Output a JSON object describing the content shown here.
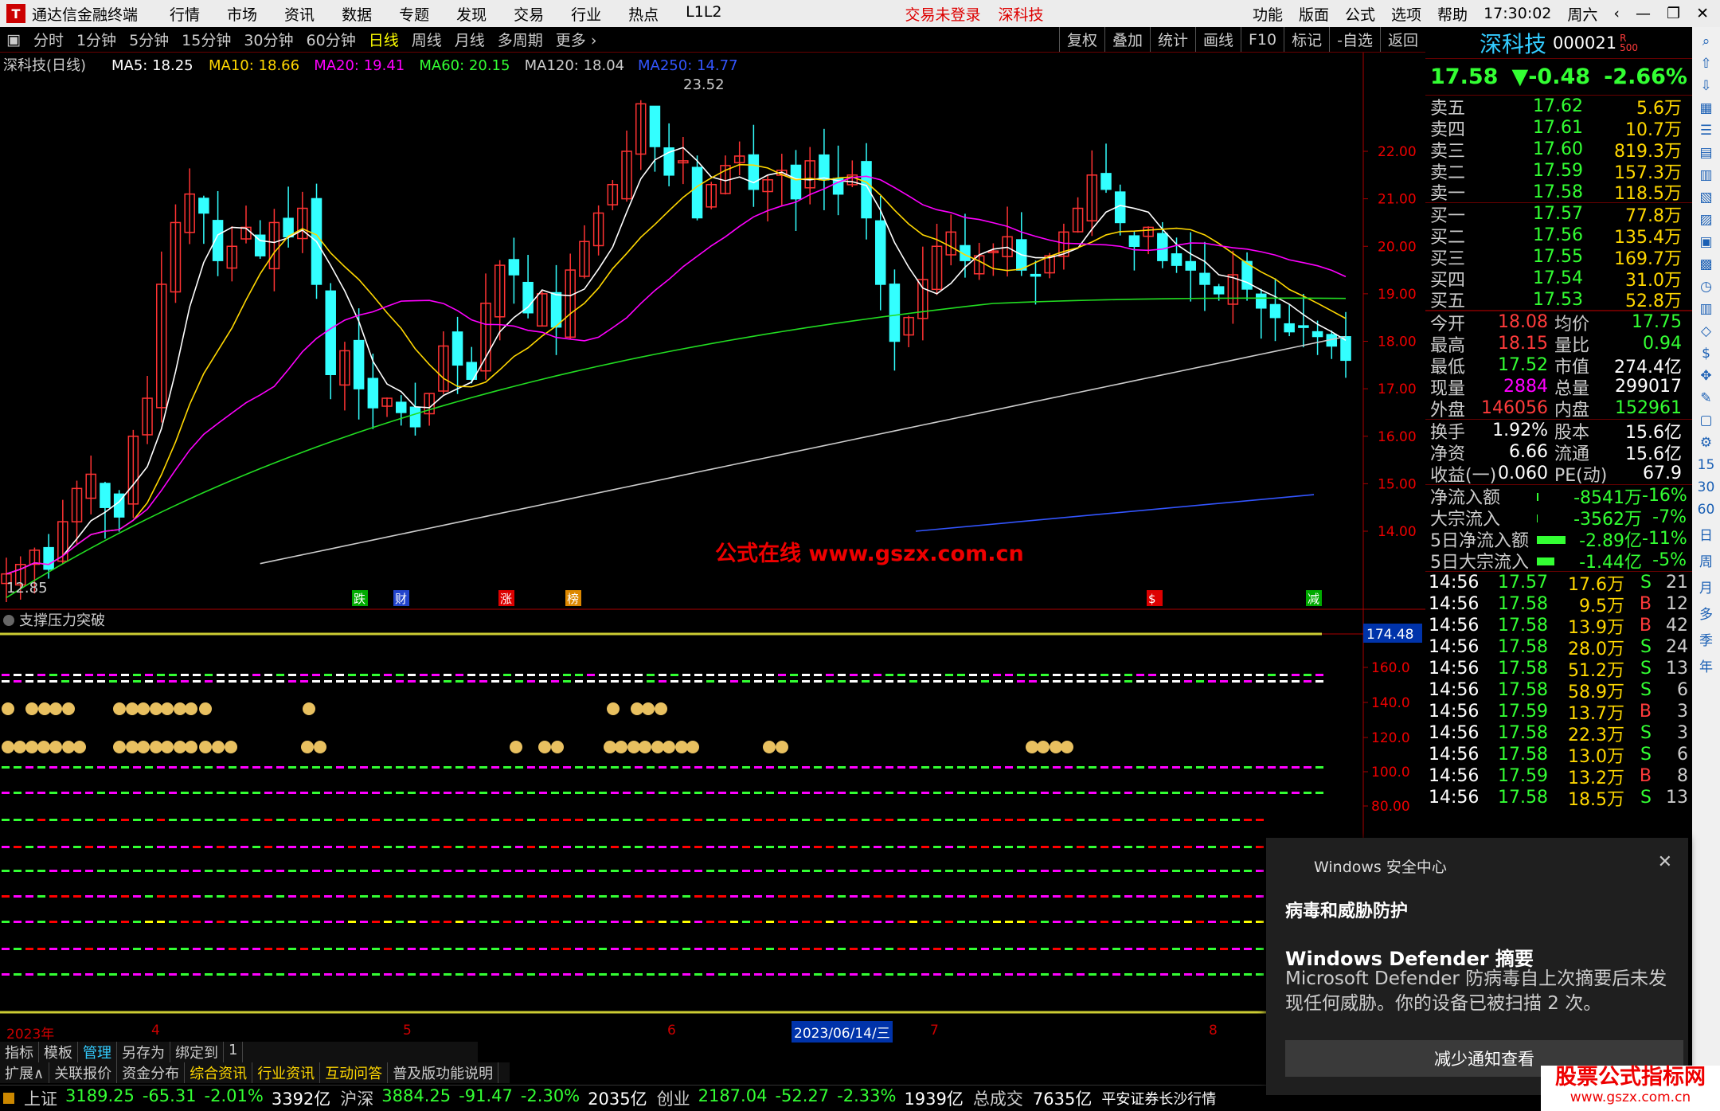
{
  "titlebar": {
    "app_title": "通达信金融终端",
    "menu": [
      "行情",
      "市场",
      "资讯",
      "数据",
      "专题",
      "发现",
      "交易",
      "行业",
      "热点",
      "L1L2"
    ],
    "warning": "交易未登录",
    "stock": "深科技",
    "right_menu": [
      "功能",
      "版面",
      "公式",
      "选项",
      "帮助"
    ],
    "time": "17:30:02",
    "weekday": "周六"
  },
  "periodbar": {
    "periods": [
      "分时",
      "1分钟",
      "5分钟",
      "15分钟",
      "30分钟",
      "60分钟",
      "日线",
      "周线",
      "月线",
      "多周期",
      "更多"
    ],
    "active": "日线",
    "tools": [
      "复权",
      "叠加",
      "统计",
      "画线",
      "F10",
      "标记",
      "-自选",
      "返回"
    ]
  },
  "ma_legend": {
    "name": "深科技(日线)",
    "items": [
      {
        "label": "MA5: 18.25",
        "color": "#ffffff"
      },
      {
        "label": "MA10: 18.66",
        "color": "#ffd700"
      },
      {
        "label": "MA20: 19.41",
        "color": "#ff00ff"
      },
      {
        "label": "MA60: 20.15",
        "color": "#33ff33"
      },
      {
        "label": "MA120: 18.04",
        "color": "#cccccc"
      },
      {
        "label": "MA250: 14.77",
        "color": "#3355ff"
      }
    ]
  },
  "main_chart": {
    "price_labels": [
      "22.00",
      "21.00",
      "20.00",
      "19.00",
      "18.00",
      "17.00",
      "16.00",
      "15.00",
      "14.00"
    ],
    "high_label": "23.52",
    "low_label": "12.85",
    "watermark": "公式在线  www.gszx.com.cn",
    "event_tags": [
      "跌",
      "财",
      "涨",
      "榜",
      "$",
      "减"
    ]
  },
  "indicator": {
    "name": "支撑压力突破",
    "value_box": "174.48",
    "axis": [
      "160.0",
      "140.0",
      "120.0",
      "100.0",
      "80.00"
    ]
  },
  "time_axis": [
    "2023年",
    "4",
    "5",
    "6",
    "2023/06/14/三",
    "7",
    "8"
  ],
  "quote": {
    "name": "深科技",
    "code": "000021",
    "flag": "R",
    "flag_sub": "500",
    "price": "17.58",
    "change": "▼-0.48",
    "pct": "-2.66%",
    "sell": [
      {
        "label": "卖五",
        "price": "17.62",
        "vol": "5.6万"
      },
      {
        "label": "卖四",
        "price": "17.61",
        "vol": "10.7万"
      },
      {
        "label": "卖三",
        "price": "17.60",
        "vol": "819.3万"
      },
      {
        "label": "卖二",
        "price": "17.59",
        "vol": "157.3万"
      },
      {
        "label": "卖一",
        "price": "17.58",
        "vol": "118.5万"
      }
    ],
    "buy": [
      {
        "label": "买一",
        "price": "17.57",
        "vol": "77.8万"
      },
      {
        "label": "买二",
        "price": "17.56",
        "vol": "135.4万"
      },
      {
        "label": "买三",
        "price": "17.55",
        "vol": "169.7万"
      },
      {
        "label": "买四",
        "price": "17.54",
        "vol": "31.0万"
      },
      {
        "label": "买五",
        "price": "17.53",
        "vol": "52.8万"
      }
    ],
    "stats": [
      {
        "l1": "今开",
        "v1": "18.08",
        "c1": "red",
        "l2": "均价",
        "v2": "17.75",
        "c2": "grn"
      },
      {
        "l1": "最高",
        "v1": "18.15",
        "c1": "red",
        "l2": "量比",
        "v2": "0.94",
        "c2": "grn"
      },
      {
        "l1": "最低",
        "v1": "17.52",
        "c1": "grn",
        "l2": "市值",
        "v2": "274.4亿",
        "c2": "wht"
      },
      {
        "l1": "现量",
        "v1": "2884",
        "c1": "mag",
        "l2": "总量",
        "v2": "299017",
        "c2": "wht"
      },
      {
        "l1": "外盘",
        "v1": "146056",
        "c1": "red",
        "l2": "内盘",
        "v2": "152961",
        "c2": "grn"
      }
    ],
    "stats2": [
      {
        "l1": "换手",
        "v1": "1.92%",
        "l2": "股本",
        "v2": "15.6亿"
      },
      {
        "l1": "净资",
        "v1": "6.66",
        "l2": "流通",
        "v2": "15.6亿"
      },
      {
        "l1": "收益(一)",
        "v1": "0.060",
        "l2": "PE(动)",
        "v2": "67.9"
      }
    ],
    "flows": [
      {
        "label": "净流入额",
        "value": "-8541万",
        "pct": "-16%",
        "bar": 0.06
      },
      {
        "label": "大宗流入",
        "value": "-3562万",
        "pct": "-7%",
        "bar": 0.01
      },
      {
        "label": "5日净流入额",
        "value": "-2.89亿",
        "pct": "-11%",
        "bar": 0.9
      },
      {
        "label": "5日大宗流入",
        "value": "-1.44亿",
        "pct": "-5%",
        "bar": 0.55
      }
    ],
    "ticks": [
      {
        "t": "14:56",
        "p": "17.57",
        "v": "17.6万",
        "s": "S",
        "n": "21"
      },
      {
        "t": "14:56",
        "p": "17.58",
        "v": "9.5万",
        "s": "B",
        "n": "12"
      },
      {
        "t": "14:56",
        "p": "17.58",
        "v": "13.9万",
        "s": "B",
        "n": "42"
      },
      {
        "t": "14:56",
        "p": "17.58",
        "v": "28.0万",
        "s": "S",
        "n": "24"
      },
      {
        "t": "14:56",
        "p": "17.58",
        "v": "51.2万",
        "s": "S",
        "n": "13"
      },
      {
        "t": "14:56",
        "p": "17.58",
        "v": "58.9万",
        "s": "S",
        "n": "6"
      },
      {
        "t": "14:56",
        "p": "17.59",
        "v": "13.7万",
        "s": "B",
        "n": "3"
      },
      {
        "t": "14:56",
        "p": "17.58",
        "v": "22.3万",
        "s": "S",
        "n": "3"
      },
      {
        "t": "14:56",
        "p": "17.58",
        "v": "13.0万",
        "s": "S",
        "n": "6"
      },
      {
        "t": "14:56",
        "p": "17.59",
        "v": "13.2万",
        "s": "B",
        "n": "8"
      },
      {
        "t": "14:56",
        "p": "17.58",
        "v": "18.5万",
        "s": "S",
        "n": "13"
      }
    ]
  },
  "right_toolbar": [
    "15",
    "30",
    "60",
    "日",
    "周",
    "月",
    "多",
    "季",
    "年"
  ],
  "tabs_row1": [
    "指标",
    "模板",
    "管理",
    "另存为",
    "绑定到",
    "1"
  ],
  "tabs_row2": [
    "扩展∧",
    "关联报价",
    "资金分布",
    "综合资讯",
    "行业资讯",
    "互动问答",
    "普及版功能说明"
  ],
  "statusbar": [
    {
      "name": "上证",
      "val": "3189.25",
      "chg": "-65.31",
      "pct": "-2.01%",
      "amt": "3392亿"
    },
    {
      "name": "沪深",
      "val": "3884.25",
      "chg": "-91.47",
      "pct": "-2.30%",
      "amt": "2035亿"
    },
    {
      "name": "创业",
      "val": "2187.04",
      "chg": "-52.27",
      "pct": "-2.33%",
      "amt": "1939亿"
    }
  ],
  "status_total_label": "总成交",
  "status_total": "7635亿",
  "status_broker": "平安证券长沙行情",
  "toast": {
    "app": "Windows 安全中心",
    "title": "病毒和威胁防护",
    "subtitle": "Windows Defender 摘要",
    "body": "Microsoft Defender 防病毒自上次摘要后未发现任何威胁。你的设备已被扫描 2 次。",
    "button": "减少通知查看"
  },
  "watermark2": {
    "line1": "股票公式指标网",
    "line2": "www.gszx.com.cn"
  }
}
